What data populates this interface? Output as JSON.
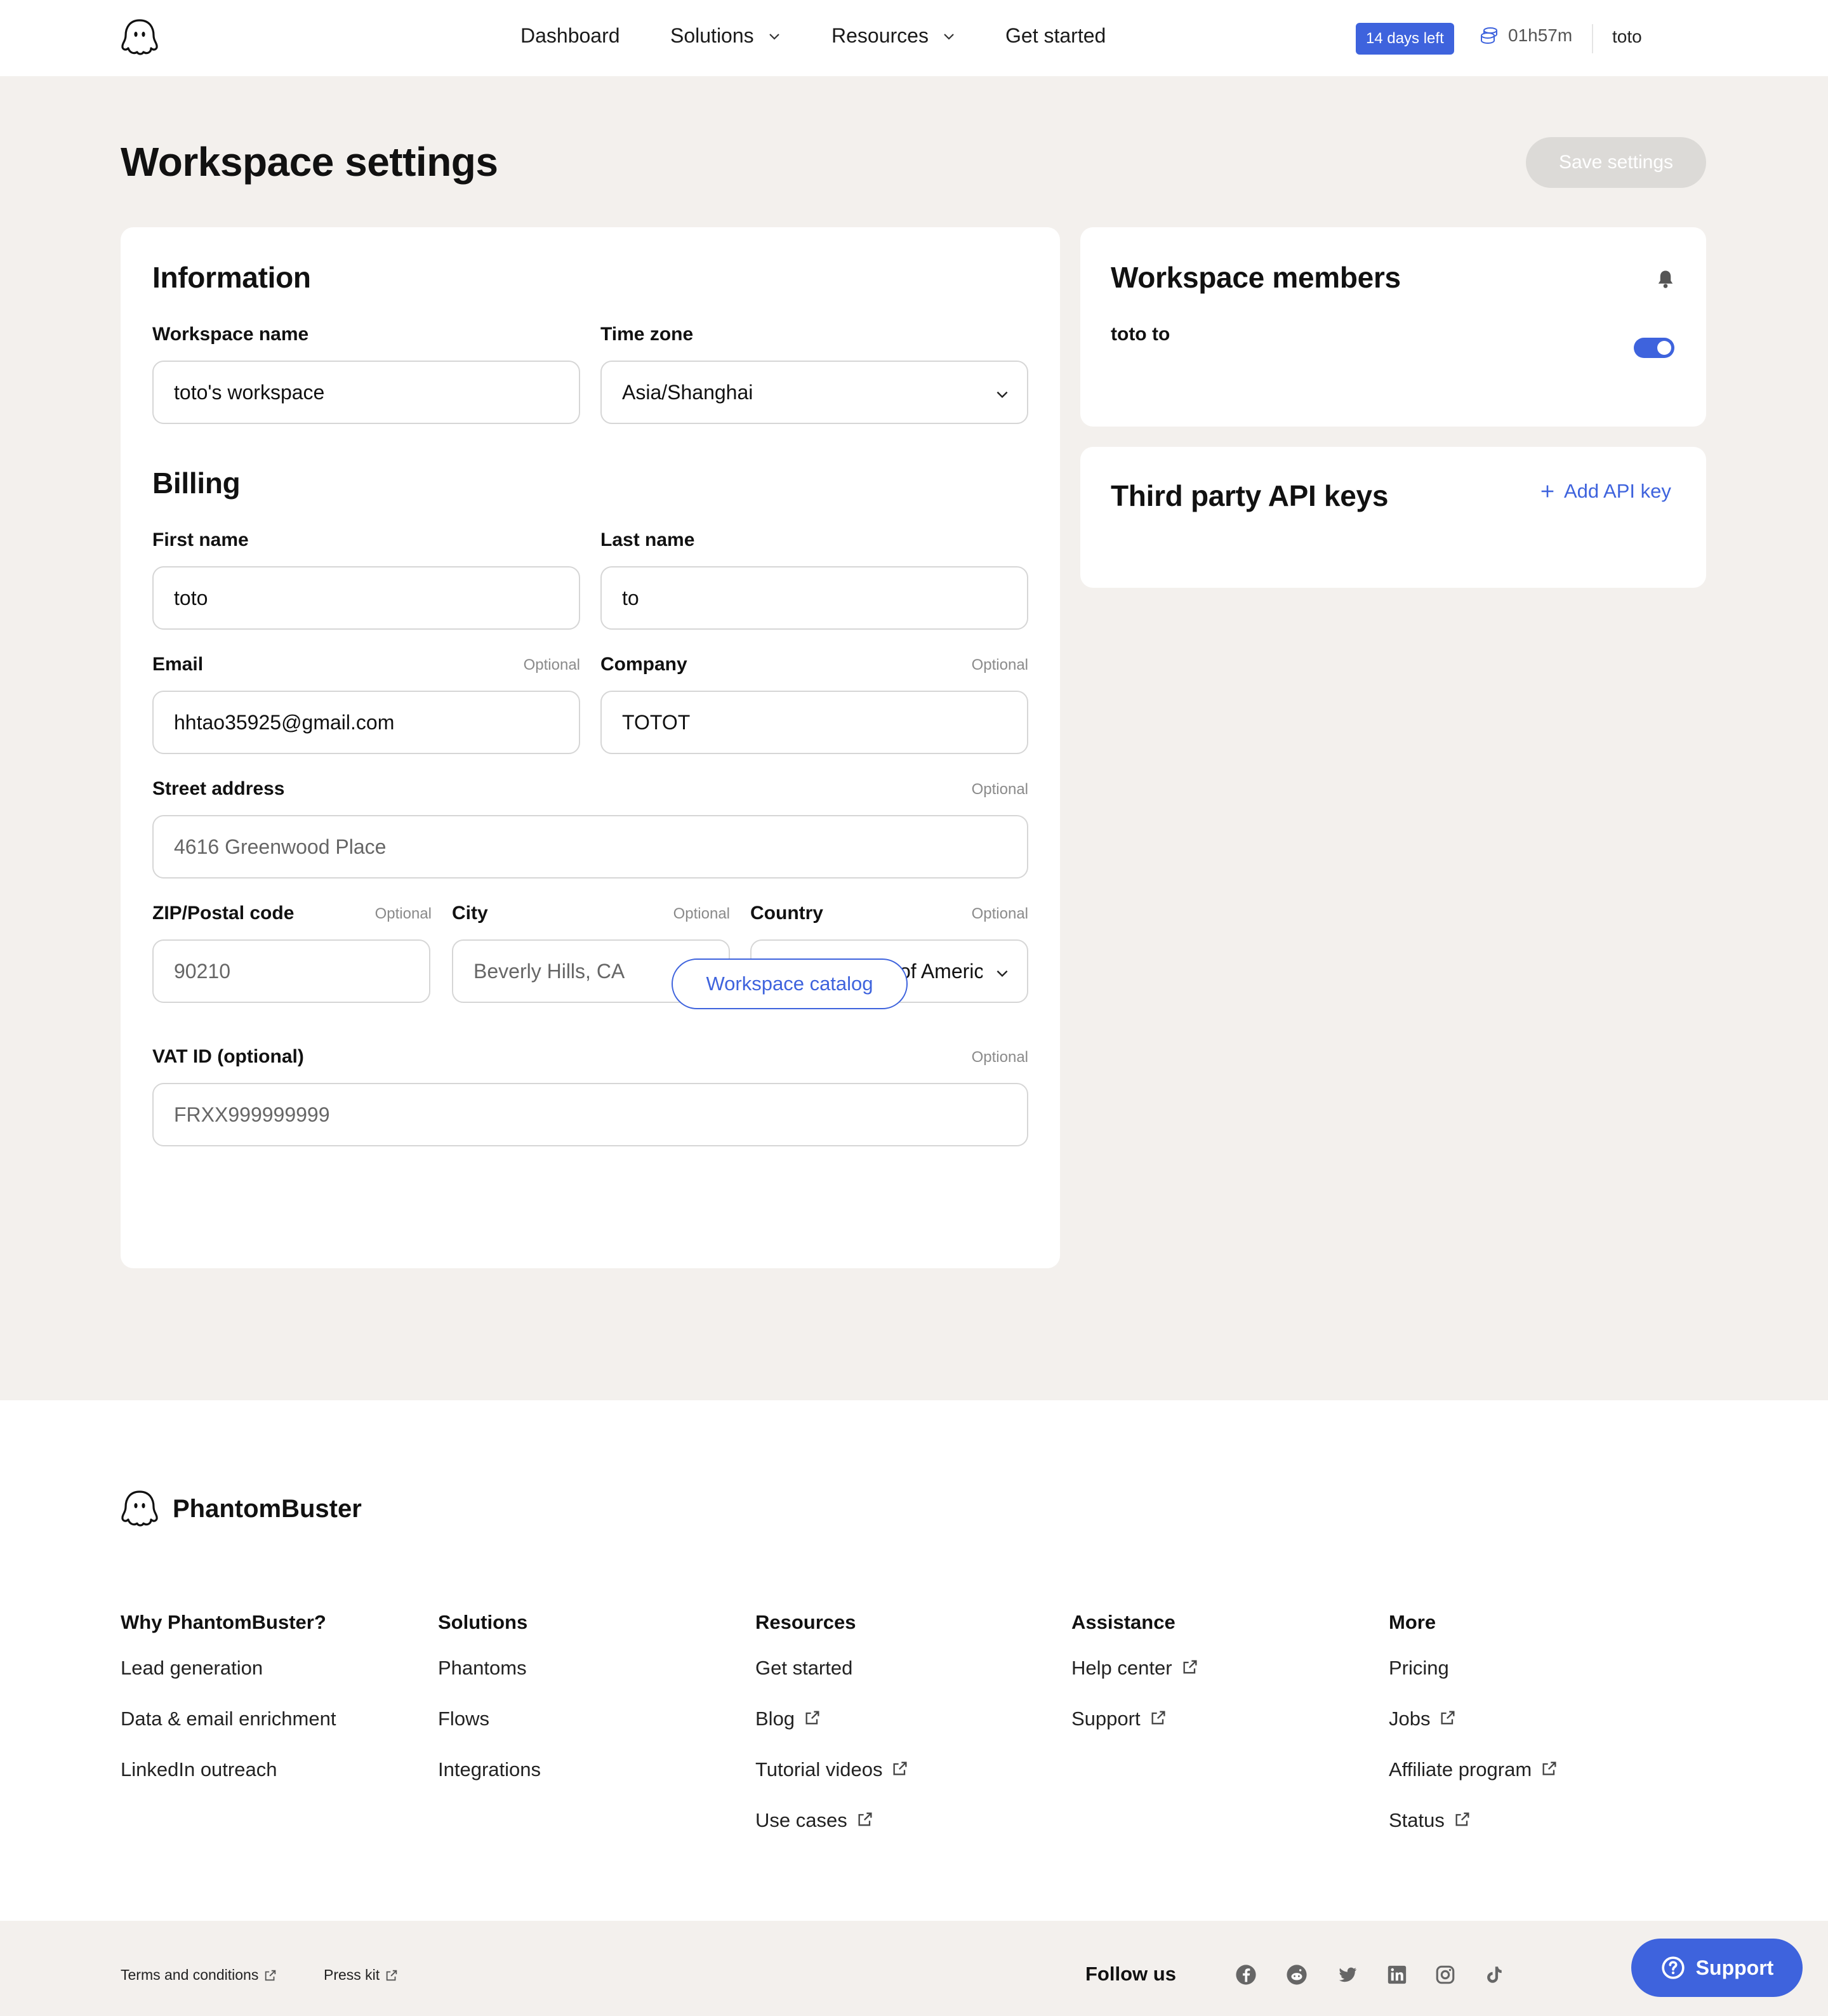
{
  "nav": {
    "items": [
      {
        "label": "Dashboard",
        "dropdown": false
      },
      {
        "label": "Solutions",
        "dropdown": true
      },
      {
        "label": "Resources",
        "dropdown": true
      },
      {
        "label": "Get started",
        "dropdown": false
      }
    ],
    "trial_badge": "14 days left",
    "time_left": "01h57m",
    "user": "toto"
  },
  "page": {
    "title": "Workspace settings",
    "save_label": "Save settings"
  },
  "information": {
    "title": "Information",
    "workspace_name_label": "Workspace name",
    "workspace_name_value": "toto's workspace",
    "timezone_label": "Time zone",
    "timezone_value": "Asia/Shanghai"
  },
  "billing": {
    "title": "Billing",
    "optional_text": "Optional",
    "first_name_label": "First name",
    "first_name_value": "toto",
    "last_name_label": "Last name",
    "last_name_value": "to",
    "email_label": "Email",
    "email_value": "hhtao35925@gmail.com",
    "company_label": "Company",
    "company_value": "TOTOT",
    "street_label": "Street address",
    "street_placeholder": "4616 Greenwood Place",
    "zip_label": "ZIP/Postal code",
    "zip_placeholder": "90210",
    "city_label": "City",
    "city_placeholder": "Beverly Hills, CA",
    "country_label": "Country",
    "country_value": "United States of Americ",
    "vat_label": "VAT ID (optional)",
    "vat_placeholder": "FRXX999999999",
    "catalog_button": "Workspace catalog"
  },
  "members": {
    "title": "Workspace members",
    "member_name": "toto to",
    "notifications_enabled": true
  },
  "api_keys": {
    "title": "Third party API keys",
    "add_label": "Add API key"
  },
  "footer": {
    "brand": "PhantomBuster",
    "columns": [
      {
        "title": "Why PhantomBuster?",
        "links": [
          {
            "label": "Lead generation",
            "external": false
          },
          {
            "label": "Data & email enrichment",
            "external": false
          },
          {
            "label": "LinkedIn outreach",
            "external": false
          }
        ]
      },
      {
        "title": "Solutions",
        "links": [
          {
            "label": "Phantoms",
            "external": false
          },
          {
            "label": "Flows",
            "external": false
          },
          {
            "label": "Integrations",
            "external": false
          }
        ]
      },
      {
        "title": "Resources",
        "links": [
          {
            "label": "Get started",
            "external": false
          },
          {
            "label": "Blog",
            "external": true
          },
          {
            "label": "Tutorial videos",
            "external": true
          },
          {
            "label": "Use cases",
            "external": true
          }
        ]
      },
      {
        "title": "Assistance",
        "links": [
          {
            "label": "Help center",
            "external": true
          },
          {
            "label": "Support",
            "external": true
          }
        ]
      },
      {
        "title": "More",
        "links": [
          {
            "label": "Pricing",
            "external": false
          },
          {
            "label": "Jobs",
            "external": true
          },
          {
            "label": "Affiliate program",
            "external": true
          },
          {
            "label": "Status",
            "external": true
          }
        ]
      }
    ],
    "terms": "Terms and conditions",
    "press": "Press kit",
    "follow_us": "Follow us",
    "social_icons": [
      "facebook-icon",
      "reddit-icon",
      "twitter-icon",
      "linkedin-icon",
      "instagram-icon",
      "tiktok-icon"
    ],
    "support_button": "Support"
  },
  "colors": {
    "accent": "#3e63dd",
    "page_bg": "#f3f0ed",
    "card_bg": "#ffffff"
  }
}
